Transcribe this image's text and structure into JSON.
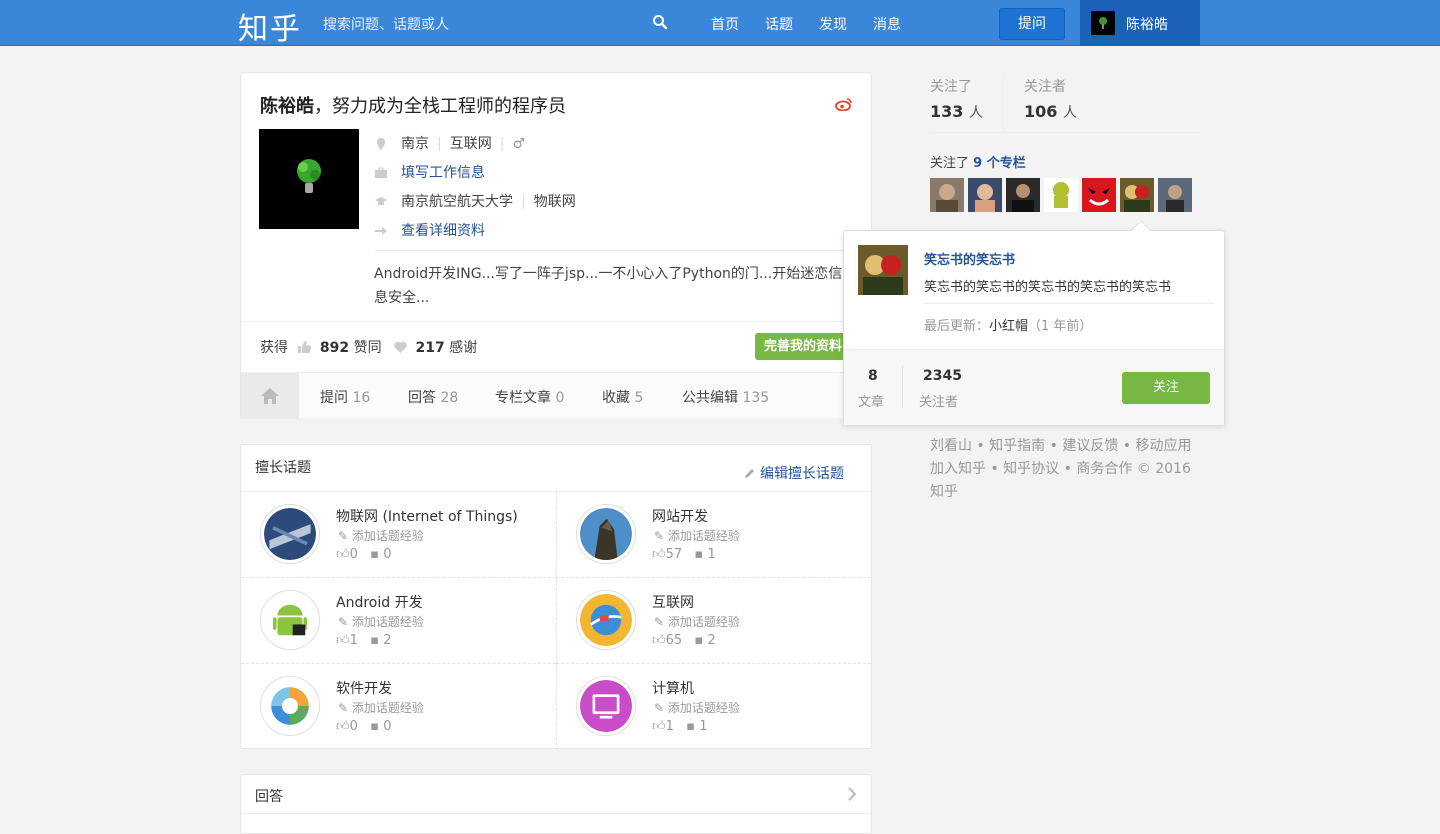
{
  "header": {
    "logo": "知乎",
    "search_placeholder": "搜索问题、话题或人",
    "nav": [
      "首页",
      "话题",
      "发现",
      "消息"
    ],
    "ask_label": "提问",
    "user_name": "陈裕皓"
  },
  "profile": {
    "name": "陈裕皓",
    "headline": "，努力成为全栈工程师的程序员",
    "location": "南京",
    "industry": "互联网",
    "gender_symbol": "♂",
    "work_link": "填写工作信息",
    "school": "南京航空航天大学",
    "major": "物联网",
    "detail_link": "查看详细资料",
    "bio": "Android开发ING...写了一阵子jsp...一不小心入了Python的门...开始迷恋信息安全...",
    "get_label": "获得",
    "agree_count": "892",
    "agree_label": "赞同",
    "thanks_count": "217",
    "thanks_label": "感谢",
    "perfect_btn": "完善我的资料",
    "tabs": [
      {
        "label": "提问",
        "count": "16"
      },
      {
        "label": "回答",
        "count": "28"
      },
      {
        "label": "专栏文章",
        "count": "0"
      },
      {
        "label": "收藏",
        "count": "5"
      },
      {
        "label": "公共编辑",
        "count": "135"
      }
    ]
  },
  "skills": {
    "title": "擅长话题",
    "edit_label": "编辑擅长话题",
    "add_label": "添加话题经验",
    "topics": [
      {
        "name": "物联网 (Internet of Things)",
        "agree": "0",
        "comments": "0"
      },
      {
        "name": "网站开发",
        "agree": "57",
        "comments": "1"
      },
      {
        "name": "Android 开发",
        "agree": "1",
        "comments": "2"
      },
      {
        "name": "互联网",
        "agree": "65",
        "comments": "2"
      },
      {
        "name": "软件开发",
        "agree": "0",
        "comments": "0"
      },
      {
        "name": "计算机",
        "agree": "1",
        "comments": "1"
      }
    ]
  },
  "answers": {
    "title": "回答"
  },
  "sidebar": {
    "following_label": "关注了",
    "following_count": "133",
    "followers_label": "关注者",
    "followers_count": "106",
    "unit": "人",
    "columns_prefix": "关注了",
    "columns_count": "9 个专栏"
  },
  "popup": {
    "title": "笑忘书的笑忘书",
    "desc": "笑忘书的笑忘书的笑忘书的笑忘书的笑忘书",
    "update_label": "最后更新：",
    "update_title": "小红帽",
    "update_time": "（1 年前）",
    "articles_count": "8",
    "articles_label": "文章",
    "followers_count": "2345",
    "followers_label": "关注者",
    "follow_btn": "关注"
  },
  "footer": {
    "links": [
      "刘看山",
      "知乎指南",
      "建议反馈",
      "移动应用",
      "加入知乎",
      "知乎协议",
      "商务合作"
    ],
    "copyright": "© 2016 知乎"
  }
}
